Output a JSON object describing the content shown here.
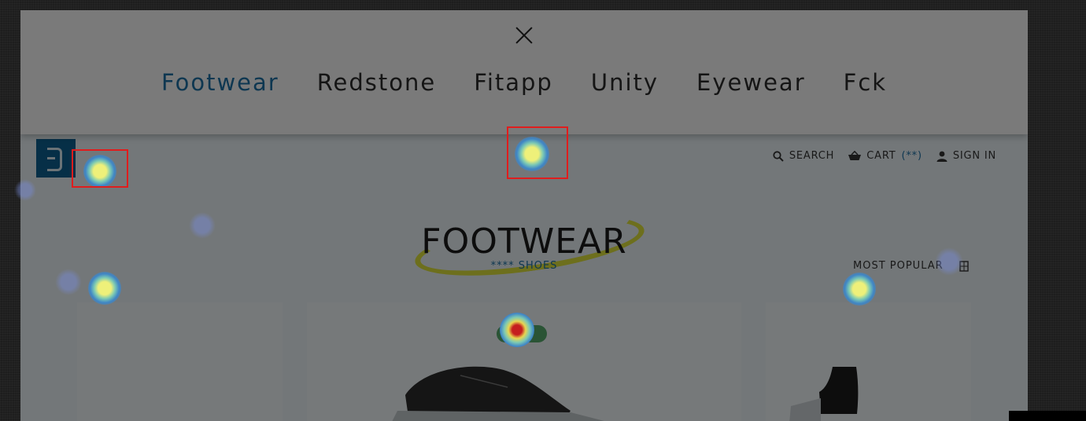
{
  "menu": {
    "close_icon": "close-icon",
    "items": [
      {
        "label": "Footwear",
        "active": true
      },
      {
        "label": "Redstone",
        "active": false
      },
      {
        "label": "Fitapp",
        "active": false
      },
      {
        "label": "Unity",
        "active": false
      },
      {
        "label": "Eyewear",
        "active": false
      },
      {
        "label": "Fck",
        "active": false
      }
    ]
  },
  "header": {
    "logo_icon": "brand-logo-icon",
    "search_label": "SEARCH",
    "cart_label": "CART",
    "cart_count": "(**)",
    "signin_label": "SIGN IN"
  },
  "page": {
    "title": "FOOTWEAR",
    "subtitle": "**** SHOES",
    "sort_label": "MOST POPULAR"
  },
  "products": {
    "badge_label": "S"
  },
  "colors": {
    "accent": "#1d6fa2",
    "highlight": "#d8dc1a",
    "badge": "#54a86b",
    "marker": "#e01d1d"
  }
}
